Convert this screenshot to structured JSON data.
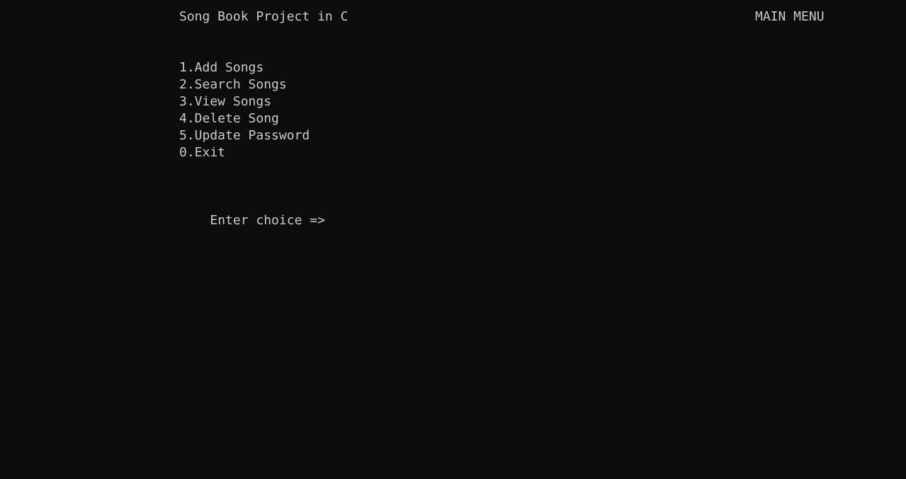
{
  "header": {
    "title": "Song Book Project in C",
    "menu_label": "MAIN MENU"
  },
  "menu": {
    "items": [
      {
        "label": "1.Add Songs"
      },
      {
        "label": "2.Search Songs"
      },
      {
        "label": "3.View Songs"
      },
      {
        "label": "4.Delete Song"
      },
      {
        "label": "5.Update Password"
      },
      {
        "label": "0.Exit"
      }
    ]
  },
  "prompt": {
    "text": "Enter choice =>",
    "input_value": ""
  },
  "colors": {
    "background": "#0c0c0c",
    "text": "#cccccc"
  }
}
